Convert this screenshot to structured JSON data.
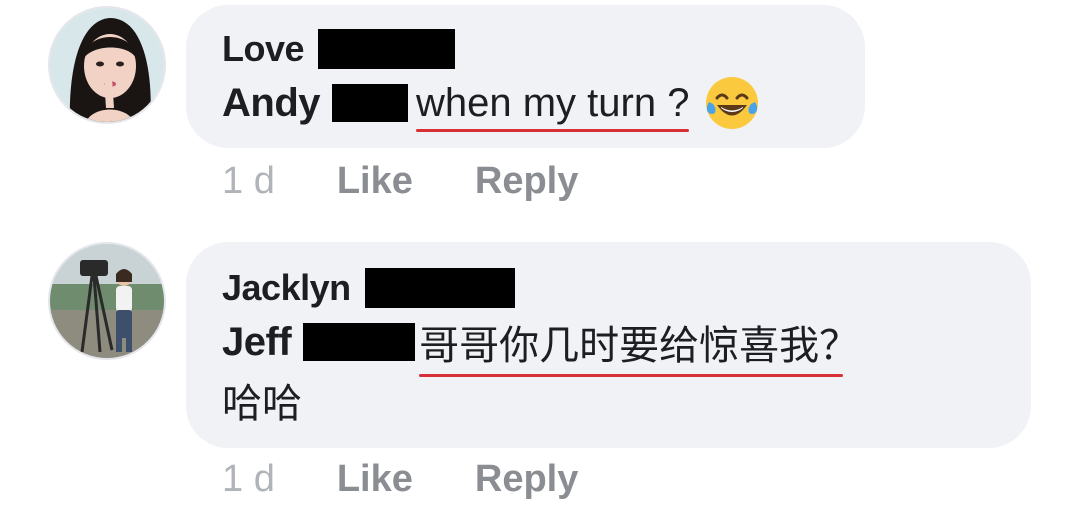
{
  "comments": [
    {
      "first_name": "Love",
      "second_name": "Andy",
      "text": "when my turn ?",
      "emoji_icon": "laughing-tears-emoji",
      "time": "1 d",
      "like_label": "Like",
      "reply_label": "Reply"
    },
    {
      "first_name": "Jacklyn",
      "second_name": "Jeff",
      "text": "哥哥你几时要给惊喜我？",
      "text_continued": "哈哈",
      "time": "1 d",
      "like_label": "Like",
      "reply_label": "Reply"
    }
  ],
  "colors": {
    "bubble": "#f0f2f5",
    "text": "#1c1e21",
    "meta": "#8a8d91",
    "spellcheck_underline": "#d93037",
    "redaction": "#000000"
  }
}
